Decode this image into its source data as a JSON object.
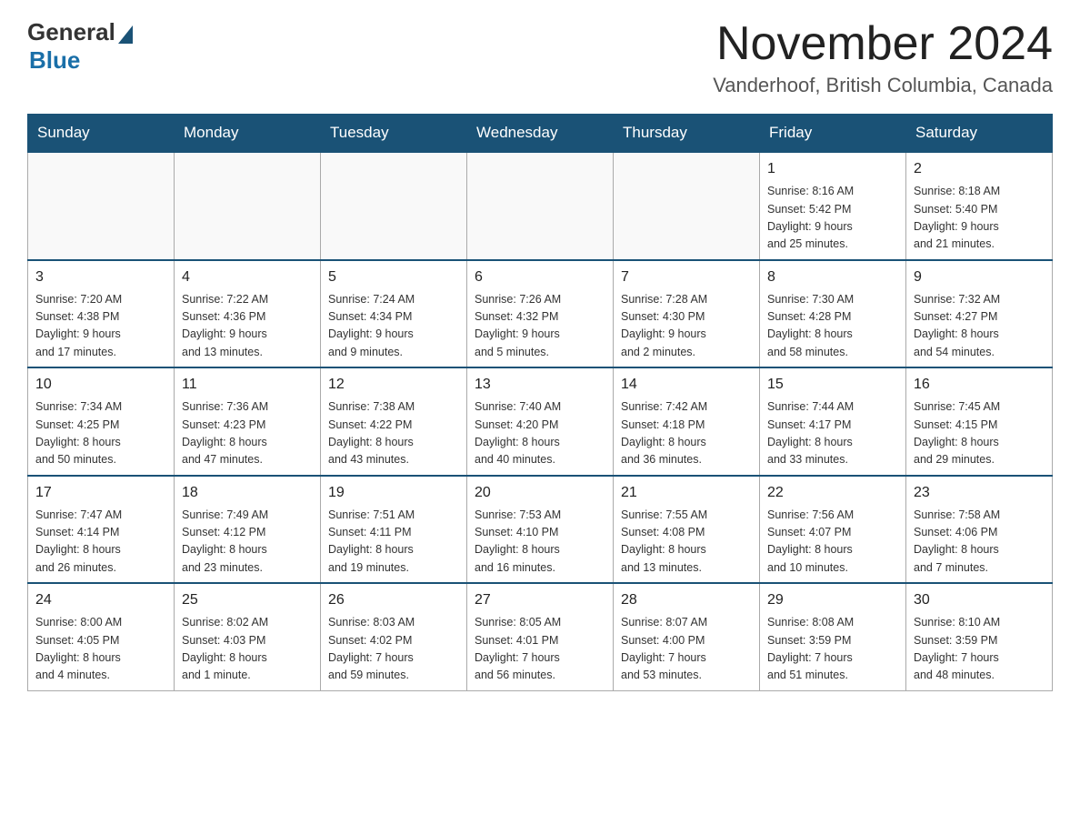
{
  "logo": {
    "general": "General",
    "blue": "Blue"
  },
  "title": "November 2024",
  "subtitle": "Vanderhoof, British Columbia, Canada",
  "days_of_week": [
    "Sunday",
    "Monday",
    "Tuesday",
    "Wednesday",
    "Thursday",
    "Friday",
    "Saturday"
  ],
  "weeks": [
    [
      {
        "day": "",
        "info": ""
      },
      {
        "day": "",
        "info": ""
      },
      {
        "day": "",
        "info": ""
      },
      {
        "day": "",
        "info": ""
      },
      {
        "day": "",
        "info": ""
      },
      {
        "day": "1",
        "info": "Sunrise: 8:16 AM\nSunset: 5:42 PM\nDaylight: 9 hours\nand 25 minutes."
      },
      {
        "day": "2",
        "info": "Sunrise: 8:18 AM\nSunset: 5:40 PM\nDaylight: 9 hours\nand 21 minutes."
      }
    ],
    [
      {
        "day": "3",
        "info": "Sunrise: 7:20 AM\nSunset: 4:38 PM\nDaylight: 9 hours\nand 17 minutes."
      },
      {
        "day": "4",
        "info": "Sunrise: 7:22 AM\nSunset: 4:36 PM\nDaylight: 9 hours\nand 13 minutes."
      },
      {
        "day": "5",
        "info": "Sunrise: 7:24 AM\nSunset: 4:34 PM\nDaylight: 9 hours\nand 9 minutes."
      },
      {
        "day": "6",
        "info": "Sunrise: 7:26 AM\nSunset: 4:32 PM\nDaylight: 9 hours\nand 5 minutes."
      },
      {
        "day": "7",
        "info": "Sunrise: 7:28 AM\nSunset: 4:30 PM\nDaylight: 9 hours\nand 2 minutes."
      },
      {
        "day": "8",
        "info": "Sunrise: 7:30 AM\nSunset: 4:28 PM\nDaylight: 8 hours\nand 58 minutes."
      },
      {
        "day": "9",
        "info": "Sunrise: 7:32 AM\nSunset: 4:27 PM\nDaylight: 8 hours\nand 54 minutes."
      }
    ],
    [
      {
        "day": "10",
        "info": "Sunrise: 7:34 AM\nSunset: 4:25 PM\nDaylight: 8 hours\nand 50 minutes."
      },
      {
        "day": "11",
        "info": "Sunrise: 7:36 AM\nSunset: 4:23 PM\nDaylight: 8 hours\nand 47 minutes."
      },
      {
        "day": "12",
        "info": "Sunrise: 7:38 AM\nSunset: 4:22 PM\nDaylight: 8 hours\nand 43 minutes."
      },
      {
        "day": "13",
        "info": "Sunrise: 7:40 AM\nSunset: 4:20 PM\nDaylight: 8 hours\nand 40 minutes."
      },
      {
        "day": "14",
        "info": "Sunrise: 7:42 AM\nSunset: 4:18 PM\nDaylight: 8 hours\nand 36 minutes."
      },
      {
        "day": "15",
        "info": "Sunrise: 7:44 AM\nSunset: 4:17 PM\nDaylight: 8 hours\nand 33 minutes."
      },
      {
        "day": "16",
        "info": "Sunrise: 7:45 AM\nSunset: 4:15 PM\nDaylight: 8 hours\nand 29 minutes."
      }
    ],
    [
      {
        "day": "17",
        "info": "Sunrise: 7:47 AM\nSunset: 4:14 PM\nDaylight: 8 hours\nand 26 minutes."
      },
      {
        "day": "18",
        "info": "Sunrise: 7:49 AM\nSunset: 4:12 PM\nDaylight: 8 hours\nand 23 minutes."
      },
      {
        "day": "19",
        "info": "Sunrise: 7:51 AM\nSunset: 4:11 PM\nDaylight: 8 hours\nand 19 minutes."
      },
      {
        "day": "20",
        "info": "Sunrise: 7:53 AM\nSunset: 4:10 PM\nDaylight: 8 hours\nand 16 minutes."
      },
      {
        "day": "21",
        "info": "Sunrise: 7:55 AM\nSunset: 4:08 PM\nDaylight: 8 hours\nand 13 minutes."
      },
      {
        "day": "22",
        "info": "Sunrise: 7:56 AM\nSunset: 4:07 PM\nDaylight: 8 hours\nand 10 minutes."
      },
      {
        "day": "23",
        "info": "Sunrise: 7:58 AM\nSunset: 4:06 PM\nDaylight: 8 hours\nand 7 minutes."
      }
    ],
    [
      {
        "day": "24",
        "info": "Sunrise: 8:00 AM\nSunset: 4:05 PM\nDaylight: 8 hours\nand 4 minutes."
      },
      {
        "day": "25",
        "info": "Sunrise: 8:02 AM\nSunset: 4:03 PM\nDaylight: 8 hours\nand 1 minute."
      },
      {
        "day": "26",
        "info": "Sunrise: 8:03 AM\nSunset: 4:02 PM\nDaylight: 7 hours\nand 59 minutes."
      },
      {
        "day": "27",
        "info": "Sunrise: 8:05 AM\nSunset: 4:01 PM\nDaylight: 7 hours\nand 56 minutes."
      },
      {
        "day": "28",
        "info": "Sunrise: 8:07 AM\nSunset: 4:00 PM\nDaylight: 7 hours\nand 53 minutes."
      },
      {
        "day": "29",
        "info": "Sunrise: 8:08 AM\nSunset: 3:59 PM\nDaylight: 7 hours\nand 51 minutes."
      },
      {
        "day": "30",
        "info": "Sunrise: 8:10 AM\nSunset: 3:59 PM\nDaylight: 7 hours\nand 48 minutes."
      }
    ]
  ]
}
